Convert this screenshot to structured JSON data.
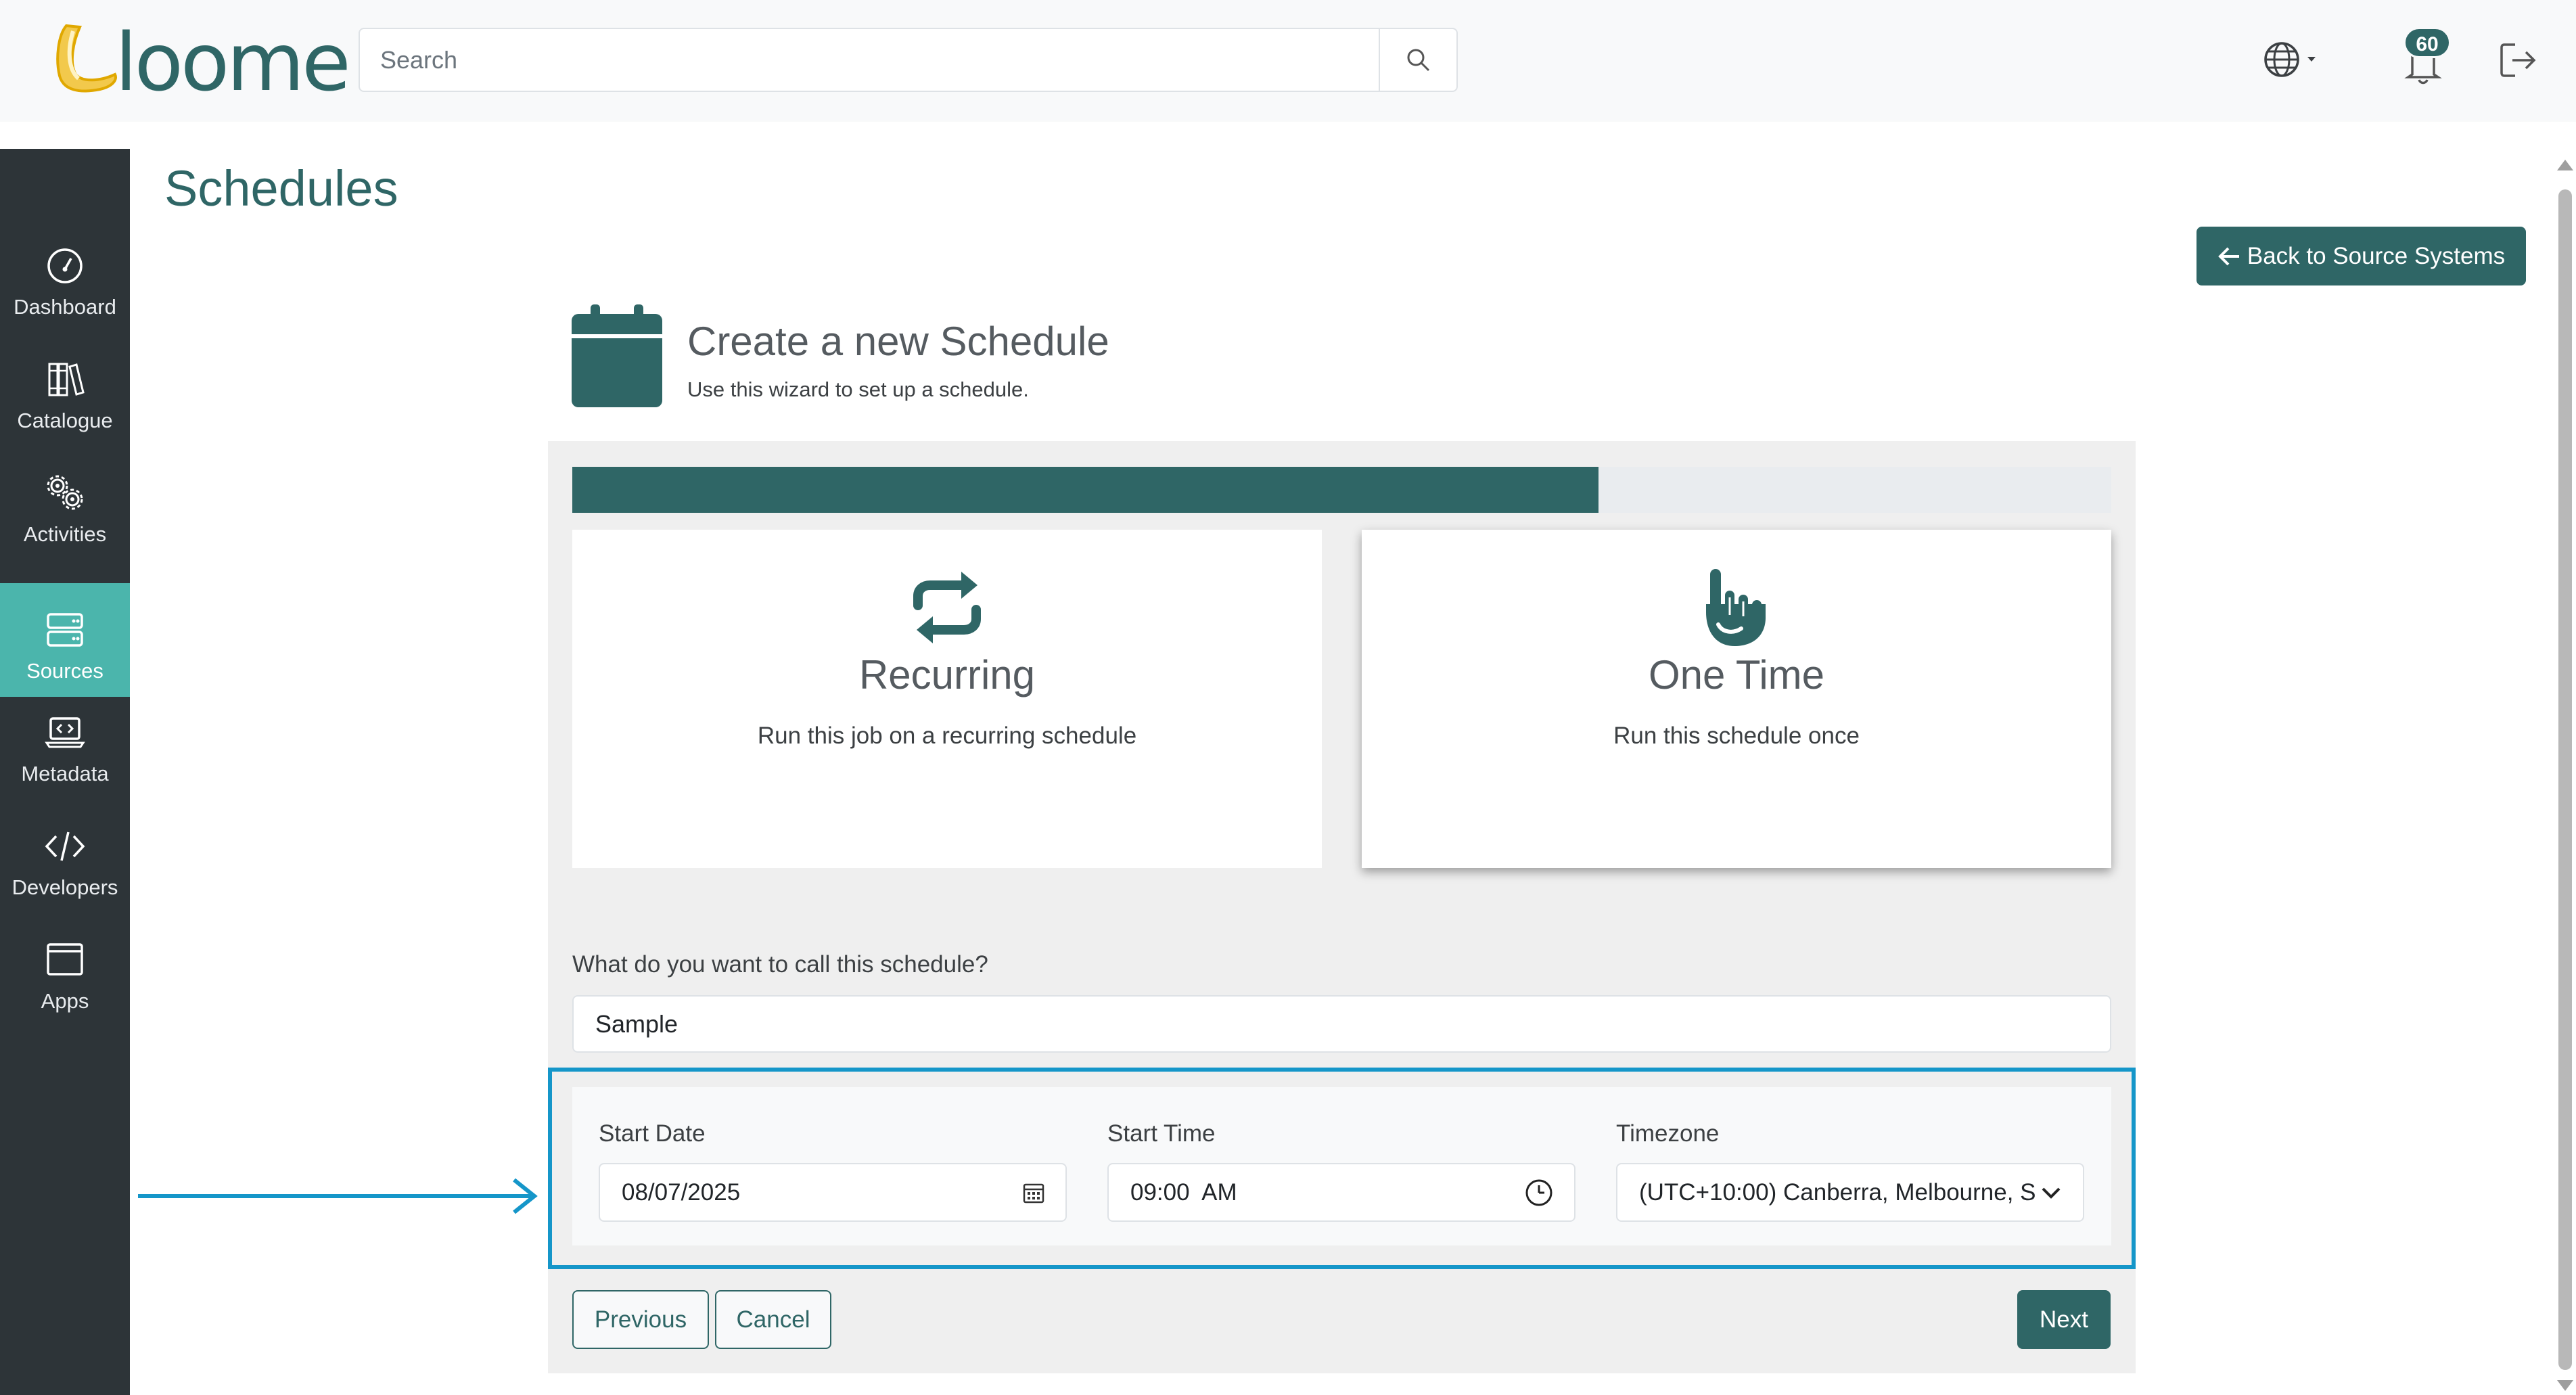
{
  "header": {
    "logo_text": "loome",
    "search": {
      "placeholder": "Search",
      "value": ""
    },
    "notifications": {
      "count": "60"
    },
    "icons": {
      "language": "globe-icon",
      "notifications": "bell-icon",
      "logout": "logout-icon",
      "search": "search-icon"
    }
  },
  "sidebar": {
    "items": [
      {
        "label": "Dashboard",
        "icon": "dashboard-gauge-icon",
        "active": false
      },
      {
        "label": "Catalogue",
        "icon": "books-icon",
        "active": false
      },
      {
        "label": "Activities",
        "icon": "gears-icon",
        "active": false
      },
      {
        "label": "Sources",
        "icon": "server-icon",
        "active": true
      },
      {
        "label": "Metadata",
        "icon": "laptop-code-icon",
        "active": false
      },
      {
        "label": "Developers",
        "icon": "code-icon",
        "active": false
      },
      {
        "label": "Apps",
        "icon": "window-icon",
        "active": false
      }
    ]
  },
  "page": {
    "title": "Schedules",
    "back_button": "Back to Source Systems"
  },
  "wizard": {
    "title": "Create a new Schedule",
    "subtitle": "Use this wizard to set up a schedule.",
    "progress": 0.667,
    "options": [
      {
        "title": "Recurring",
        "description": "Run this job on a recurring schedule",
        "icon": "repeat-icon",
        "selected": false
      },
      {
        "title": "One Time",
        "description": "Run this schedule once",
        "icon": "hand-pointer-icon",
        "selected": true
      }
    ],
    "name_label": "What do you want to call this schedule?",
    "name_value": "Sample",
    "start_date": {
      "label": "Start Date",
      "value": "08/07/2025"
    },
    "start_time": {
      "label": "Start Time",
      "value": "09:00  AM"
    },
    "timezone": {
      "label": "Timezone",
      "value": "(UTC+10:00) Canberra, Melbourne, S"
    },
    "buttons": {
      "previous": "Previous",
      "cancel": "Cancel",
      "next": "Next"
    }
  },
  "colors": {
    "brand": "#2f6666",
    "sidebar_bg": "#2d3438",
    "active_nav": "#4bb5ac",
    "highlight": "#1596c9"
  }
}
